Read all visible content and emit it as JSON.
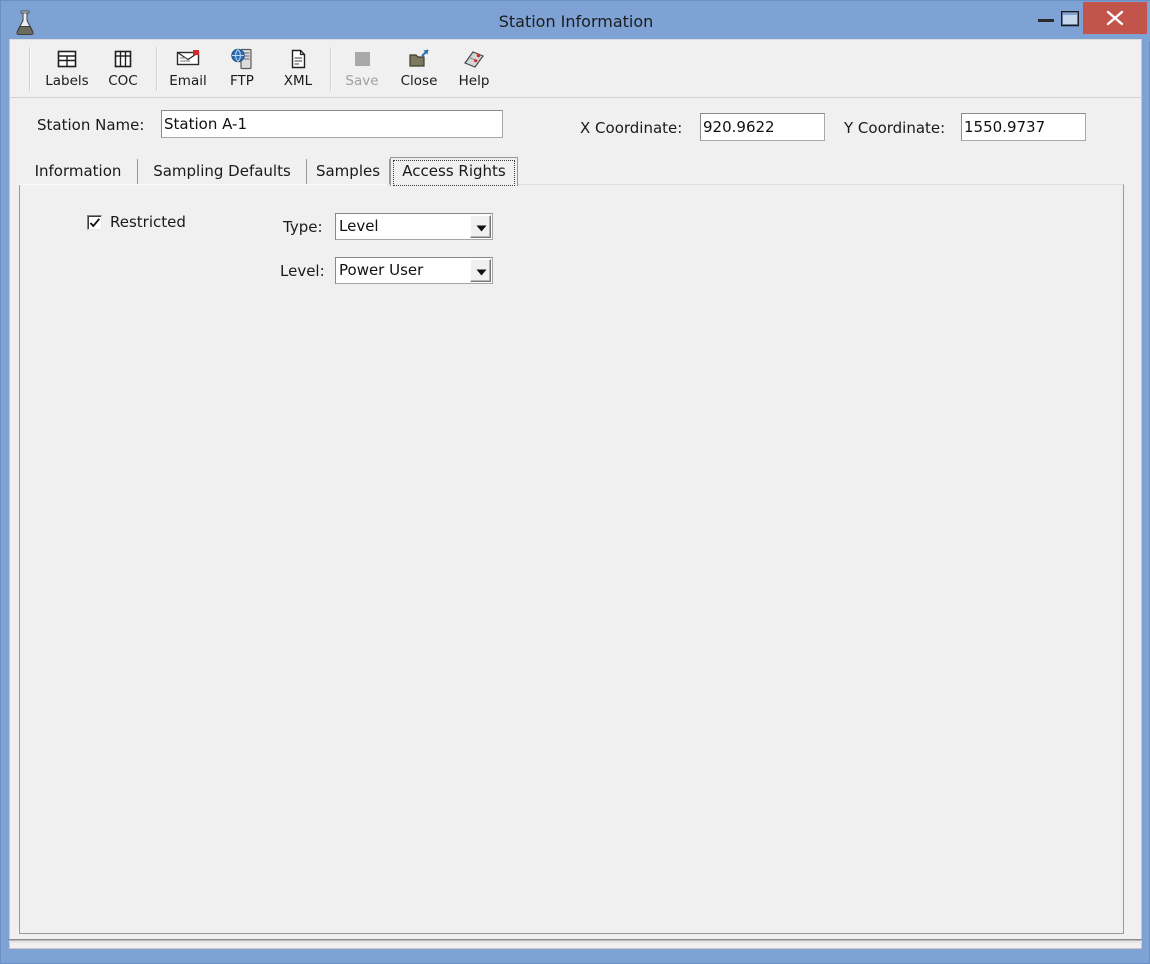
{
  "window": {
    "title": "Station Information",
    "icon": "flask-icon",
    "controls": {
      "minimize": "minimize-button",
      "maximize": "maximize-button",
      "close": "close-button"
    },
    "accent_titlebar": "#7fa2d4",
    "accent_close": "#c3544c"
  },
  "toolbar": {
    "buttons": [
      {
        "label": "Labels",
        "icon": "table-labels-icon",
        "enabled": true
      },
      {
        "label": "COC",
        "icon": "table-coc-icon",
        "enabled": true
      },
      {
        "label": "Email",
        "icon": "envelope-icon",
        "enabled": true
      },
      {
        "label": "FTP",
        "icon": "server-globe-icon",
        "enabled": true
      },
      {
        "label": "XML",
        "icon": "document-icon",
        "enabled": true
      },
      {
        "label": "Save",
        "icon": "save-icon",
        "enabled": false
      },
      {
        "label": "Close",
        "icon": "folder-exit-icon",
        "enabled": true
      },
      {
        "label": "Help",
        "icon": "help-book-icon",
        "enabled": true
      }
    ]
  },
  "header_fields": {
    "station_name_label": "Station Name:",
    "station_name_value": "Station A-1",
    "station_name_placeholder": "",
    "x_coordinate_label": "X Coordinate:",
    "x_coordinate_value": "920.9622",
    "y_coordinate_label": "Y Coordinate:",
    "y_coordinate_value": "1550.9737"
  },
  "tabs": {
    "items": [
      {
        "label": "Information",
        "active": false
      },
      {
        "label": "Sampling Defaults",
        "active": false
      },
      {
        "label": "Samples",
        "active": false
      },
      {
        "label": "Access Rights",
        "active": true
      }
    ],
    "active_index": 3
  },
  "access_rights": {
    "restricted_label": "Restricted",
    "restricted_checked": true,
    "type_label": "Type:",
    "type_value": "Level",
    "type_options": [
      "Level"
    ],
    "level_label": "Level:",
    "level_value": "Power User",
    "level_options": [
      "Power User"
    ]
  }
}
